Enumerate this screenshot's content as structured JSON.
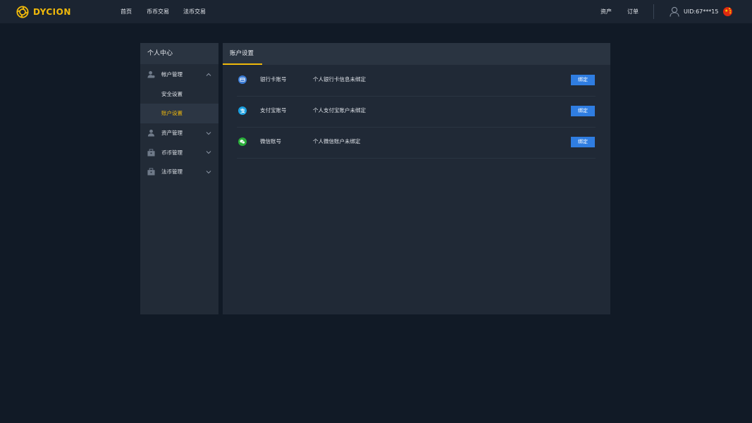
{
  "brand": {
    "name": "DYCION",
    "accent": "#f0b90b"
  },
  "topnav": {
    "items": [
      {
        "label": "首页"
      },
      {
        "label": "币币交易"
      },
      {
        "label": "法币交易"
      }
    ],
    "right": {
      "assets": "资产",
      "orders": "订单",
      "uid": "UID:67***15",
      "language_flag": "china-flag-icon"
    }
  },
  "sidebar": {
    "title": "个人中心",
    "groups": [
      {
        "label": "帐户管理",
        "icon": "user-icon",
        "expanded": true,
        "children": [
          {
            "label": "安全设置"
          },
          {
            "label": "账户设置",
            "active": true
          }
        ]
      },
      {
        "label": "资产管理",
        "icon": "asset-user-icon",
        "expanded": false
      },
      {
        "label": "币币管理",
        "icon": "briefcase-icon",
        "expanded": false
      },
      {
        "label": "法币管理",
        "icon": "briefcase-icon",
        "expanded": false
      }
    ]
  },
  "main": {
    "tab": "账户设置",
    "accounts": [
      {
        "name": "银行卡账号",
        "status": "个人银行卡信息未绑定",
        "button": "绑定",
        "icon": "bank-card-icon",
        "color": "#3a7bd5"
      },
      {
        "name": "支付宝账号",
        "status": "个人支付宝账户未绑定",
        "button": "绑定",
        "icon": "alipay-icon",
        "color": "#1a9fe0"
      },
      {
        "name": "微信账号",
        "status": "个人微信账户未绑定",
        "button": "绑定",
        "icon": "wechat-icon",
        "color": "#2aae3a"
      }
    ]
  }
}
